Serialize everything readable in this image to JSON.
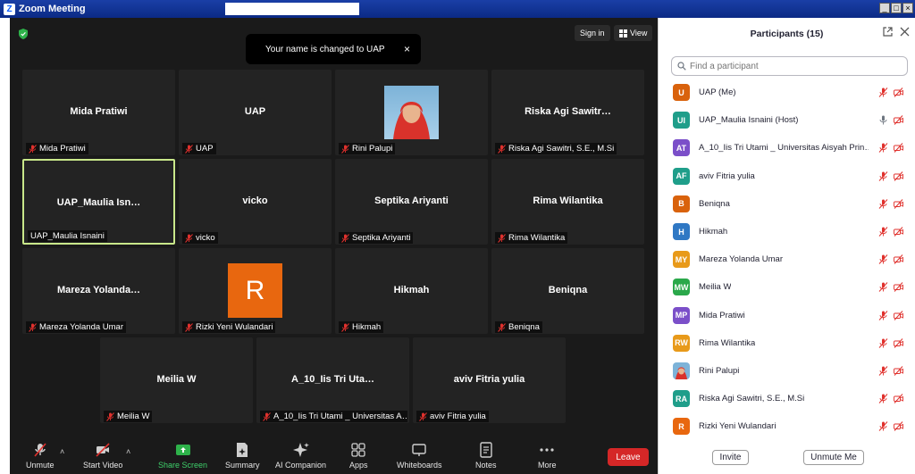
{
  "window": {
    "title": "Zoom Meeting"
  },
  "top": {
    "sign_in": "Sign in",
    "view": "View"
  },
  "toast": {
    "message": "Your name is changed to UAP",
    "close": "×"
  },
  "tiles": [
    {
      "name": "Mida Pratiwi",
      "label": "Mida Pratiwi",
      "kind": "name"
    },
    {
      "name": "UAP",
      "label": "UAP",
      "kind": "name"
    },
    {
      "name": "",
      "label": "Rini Palupi",
      "kind": "photo"
    },
    {
      "name": "Riska Agi Sawitr…",
      "label": "Riska Agi Sawitri, S.E., M.Si",
      "kind": "name"
    },
    {
      "name": "UAP_Maulia Isn…",
      "label": "UAP_Maulia Isnaini",
      "kind": "active"
    },
    {
      "name": "vicko",
      "label": "vicko",
      "kind": "name"
    },
    {
      "name": "Septika Ariyanti",
      "label": "Septika Ariyanti",
      "kind": "name"
    },
    {
      "name": "Rima Wilantika",
      "label": "Rima Wilantika",
      "kind": "name"
    },
    {
      "name": "Mareza Yolanda…",
      "label": "Mareza Yolanda Umar",
      "kind": "name"
    },
    {
      "name": "R",
      "label": "Rizki Yeni Wulandari",
      "kind": "letter"
    },
    {
      "name": "Hikmah",
      "label": "Hikmah",
      "kind": "name"
    },
    {
      "name": "Beniqna",
      "label": "Beniqna",
      "kind": "name"
    },
    {
      "name": "Meilia W",
      "label": "Meilia W",
      "kind": "name"
    },
    {
      "name": "A_10_Iis Tri Uta…",
      "label": "A_10_Iis Tri Utami _ Universitas A…",
      "kind": "name"
    },
    {
      "name": "aviv Fitria yulia",
      "label": "aviv Fitria yulia",
      "kind": "name"
    }
  ],
  "toolbar": {
    "unmute": "Unmute",
    "start_video": "Start Video",
    "share_screen": "Share Screen",
    "summary": "Summary",
    "ai_companion": "AI Companion",
    "apps": "Apps",
    "whiteboards": "Whiteboards",
    "notes": "Notes",
    "more": "More",
    "leave": "Leave"
  },
  "panel": {
    "title": "Participants (15)",
    "search_placeholder": "Find a participant",
    "invite": "Invite",
    "unmute_me": "Unmute Me",
    "participants": [
      {
        "initials": "U",
        "name": "UAP (Me)",
        "color": "#d9620c",
        "audio": "muted"
      },
      {
        "initials": "UI",
        "name": "UAP_Maulia Isnaini (Host)",
        "color": "#1f9e8a",
        "audio": "on"
      },
      {
        "initials": "AT",
        "name": "A_10_Iis Tri Utami _ Universitas Aisyah Prin…",
        "color": "#7b4fc9",
        "audio": "muted"
      },
      {
        "initials": "AF",
        "name": "aviv Fitria yulia",
        "color": "#1f9e8a",
        "audio": "muted"
      },
      {
        "initials": "B",
        "name": "Beniqna",
        "color": "#d9620c",
        "audio": "muted"
      },
      {
        "initials": "H",
        "name": "Hikmah",
        "color": "#2f78c4",
        "audio": "muted"
      },
      {
        "initials": "MY",
        "name": "Mareza Yolanda Umar",
        "color": "#e89a1a",
        "audio": "muted"
      },
      {
        "initials": "MW",
        "name": "Meilia W",
        "color": "#2aa84a",
        "audio": "muted"
      },
      {
        "initials": "MP",
        "name": "Mida Pratiwi",
        "color": "#7b4fc9",
        "audio": "muted"
      },
      {
        "initials": "RW",
        "name": "Rima Wilantika",
        "color": "#e89a1a",
        "audio": "muted"
      },
      {
        "initials": "",
        "name": "Rini Palupi",
        "color": "#7db3d8",
        "audio": "muted"
      },
      {
        "initials": "RA",
        "name": "Riska Agi Sawitri, S.E., M.Si",
        "color": "#1f9e8a",
        "audio": "muted"
      },
      {
        "initials": "R",
        "name": "Rizki Yeni Wulandari",
        "color": "#e8670f",
        "audio": "muted"
      }
    ]
  }
}
